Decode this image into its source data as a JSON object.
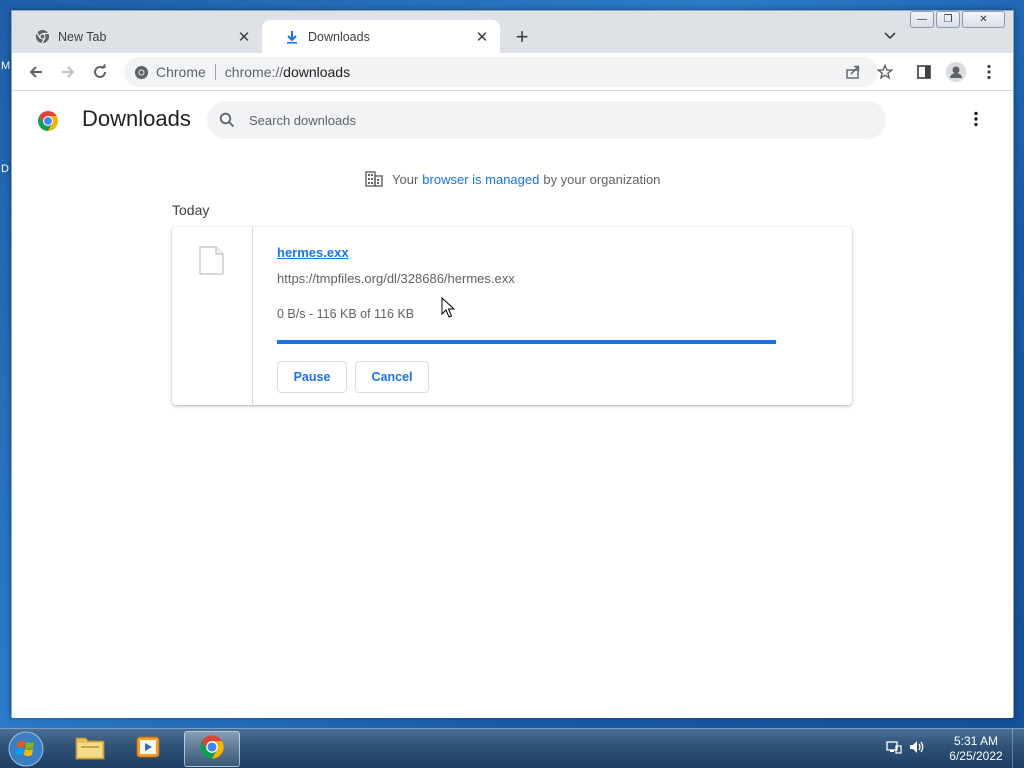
{
  "desktop": {
    "edge_chars": [
      "M",
      "D"
    ]
  },
  "browser": {
    "tabs": [
      {
        "title": "New Tab",
        "icon": "chrome-icon",
        "active": false
      },
      {
        "title": "Downloads",
        "icon": "download-arrow-icon",
        "active": true
      }
    ],
    "new_tab_label": "+",
    "window_controls": {
      "minimize": "—",
      "restore": "❐",
      "close": "✕"
    },
    "omnibox": {
      "scheme_label": "Chrome",
      "url_prefix": "chrome://",
      "url_host": "downloads"
    }
  },
  "downloads_page": {
    "title": "Downloads",
    "search_placeholder": "Search downloads",
    "managed_notice": {
      "before": "Your",
      "link": "browser is managed",
      "after": "by your organization"
    },
    "section_label": "Today",
    "items": [
      {
        "filename": "hermes.exx",
        "url": "https://tmpfiles.org/dl/328686/hermes.exx",
        "status": "0 B/s - 116 KB of 116 KB",
        "progress_percent": 100,
        "buttons": {
          "pause": "Pause",
          "cancel": "Cancel"
        }
      }
    ]
  },
  "taskbar": {
    "apps": [
      "start-button",
      "explorer",
      "media-player",
      "chrome"
    ],
    "clock": {
      "time": "5:31 AM",
      "date": "6/25/2022"
    }
  },
  "colors": {
    "accent": "#1a73e8",
    "tab_strip": "#dee1e6",
    "taskbar": "#2f5276"
  }
}
